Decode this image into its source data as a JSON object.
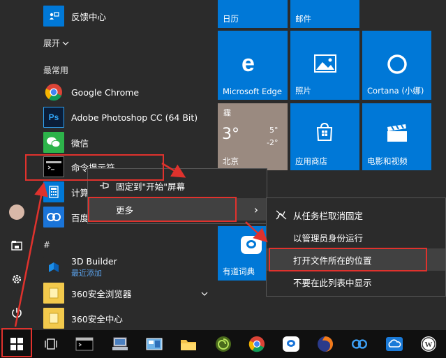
{
  "applist": {
    "feedback_label": "反馈中心",
    "expand_label": "展开",
    "section_frequent": "最常用",
    "section_hash": "#",
    "apps": [
      {
        "label": "Google Chrome"
      },
      {
        "label": "Adobe Photoshop CC (64 Bit)"
      },
      {
        "label": "微信"
      },
      {
        "label": "命令提示符"
      },
      {
        "label": "计算器"
      },
      {
        "label": "百度"
      }
    ],
    "hash_apps": [
      {
        "label": "3D Builder",
        "sub": "最近添加"
      },
      {
        "label": "360安全浏览器"
      },
      {
        "label": "360安全中心"
      }
    ]
  },
  "tiles": {
    "calendar": "日历",
    "mail": "邮件",
    "edge": "Microsoft Edge",
    "photos": "照片",
    "cortana": "Cortana (小娜)",
    "weather": {
      "condition": "霾",
      "temp": "3°",
      "high": "5°",
      "low": "-2°",
      "city": "北京"
    },
    "store": "应用商店",
    "movies": "电影和视频",
    "youdao": "有道词典"
  },
  "menu1": {
    "pin_start": "固定到\"开始\"屏幕",
    "more": "更多",
    "more_arrow": "›"
  },
  "menu2": {
    "unpin_taskbar": "从任务栏取消固定",
    "run_admin": "以管理员身份运行",
    "open_location": "打开文件所在的位置",
    "hide_list": "不要在此列表中显示"
  },
  "colors": {
    "accent": "#0078d7",
    "annotation": "#e0322d"
  }
}
